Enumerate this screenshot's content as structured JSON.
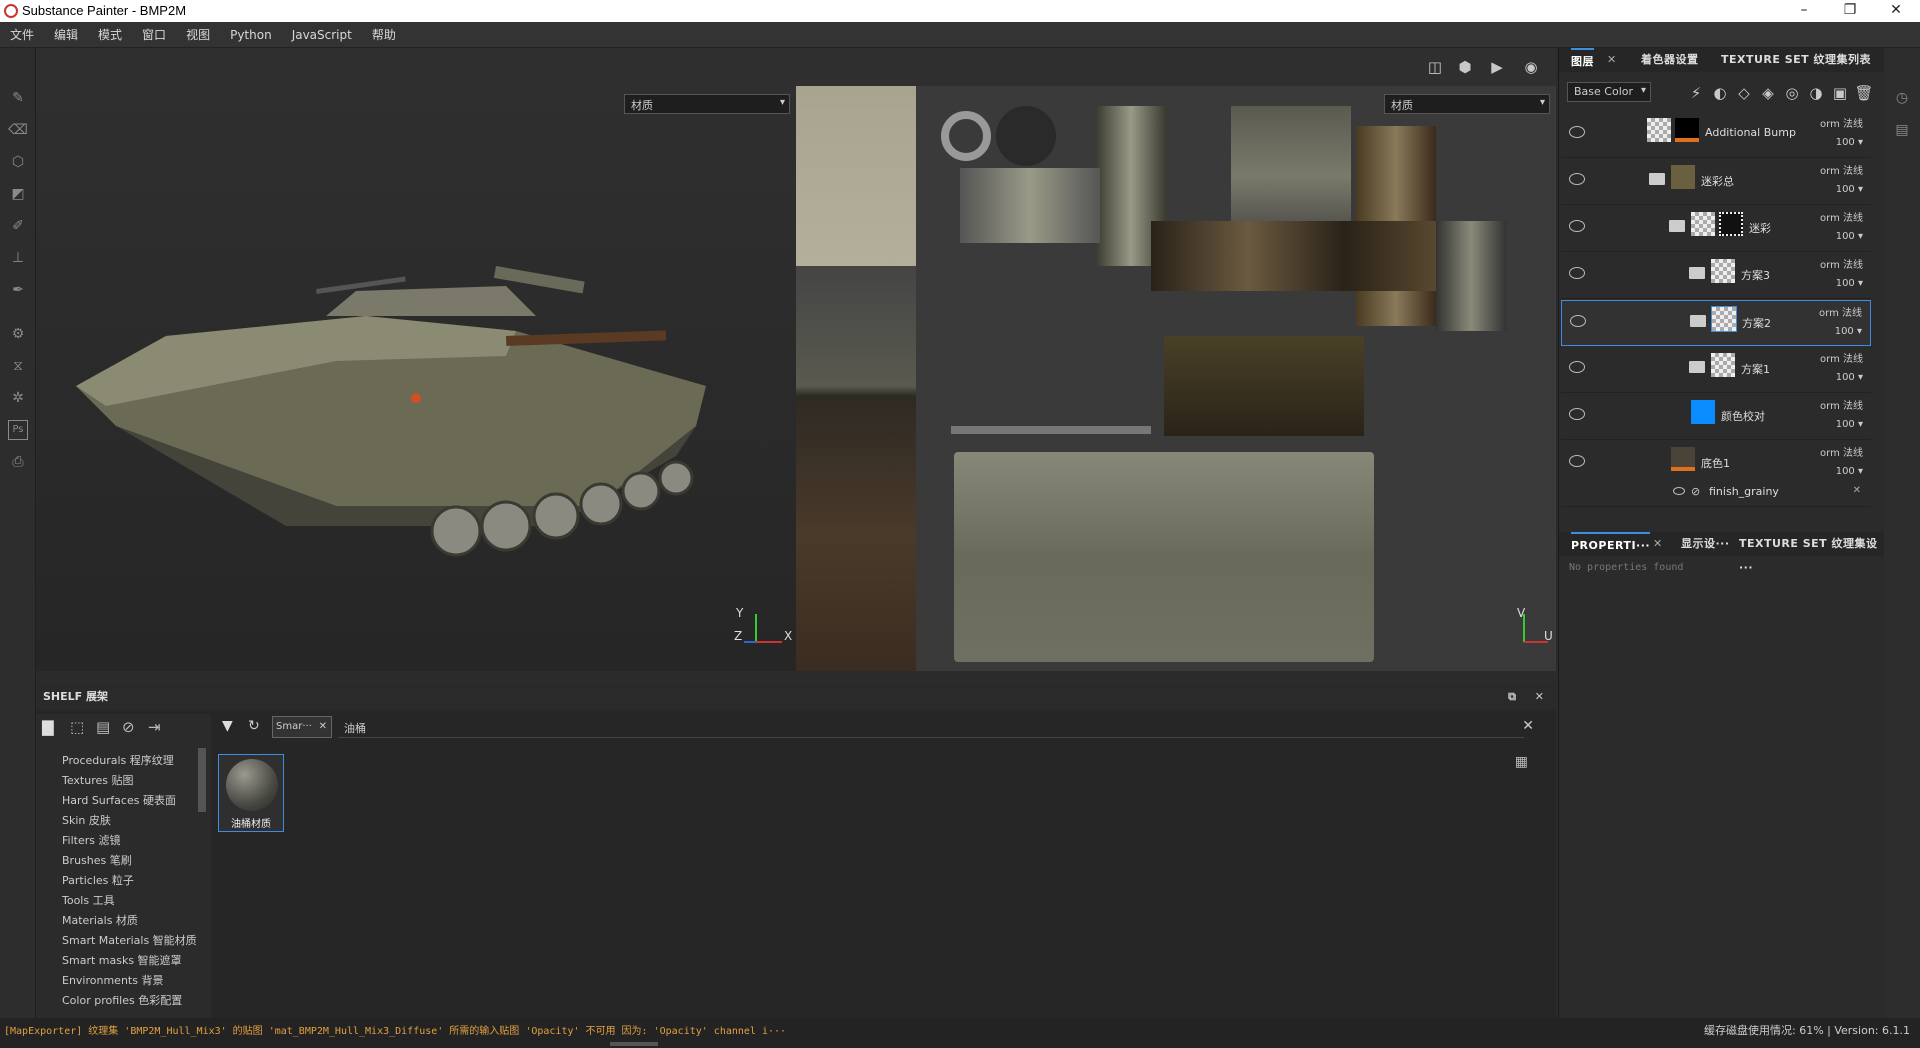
{
  "window": {
    "title": "Substance Painter - BMP2M"
  },
  "menu": [
    "文件",
    "编辑",
    "模式",
    "窗口",
    "视图",
    "Python",
    "JavaScript",
    "帮助"
  ],
  "viewport": {
    "left_dropdown": "材质",
    "right_dropdown": "材质",
    "axis_3d": {
      "y": "Y",
      "z": "Z",
      "x": "X"
    },
    "axis_2d": {
      "v": "V",
      "u": "U"
    }
  },
  "layers_panel": {
    "tabs": [
      "图层",
      "着色器设置",
      "TEXTURE SET 纹理集列表"
    ],
    "channel": "Base Color",
    "layers": [
      {
        "name": "Additional Bump",
        "blend": "orm 法线",
        "opacity": "100"
      },
      {
        "name": "迷彩总",
        "blend": "orm 法线",
        "opacity": "100"
      },
      {
        "name": "迷彩",
        "blend": "orm 法线",
        "opacity": "100"
      },
      {
        "name": "方案3",
        "blend": "orm 法线",
        "opacity": "100"
      },
      {
        "name": "方案2",
        "blend": "orm 法线",
        "opacity": "100"
      },
      {
        "name": "方案1",
        "blend": "orm 法线",
        "opacity": "100"
      },
      {
        "name": "颜色校对",
        "blend": "orm 法线",
        "opacity": "100"
      },
      {
        "name": "底色1",
        "blend": "orm 法线",
        "opacity": "100"
      }
    ],
    "effect": "finish_grainy"
  },
  "properties_panel": {
    "tabs": [
      "PROPERTI···",
      "显示设···",
      "TEXTURE SET 纹理集设···"
    ],
    "empty_text": "No properties found"
  },
  "shelf": {
    "title": "SHELF 展架",
    "categories": [
      "Procedurals 程序纹理",
      "Textures 贴图",
      "Hard Surfaces 硬表面",
      "Skin 皮肤",
      "Filters 滤镜",
      "Brushes 笔刷",
      "Particles 粒子",
      "Tools 工具",
      "Materials 材质",
      "Smart Materials 智能材质",
      "Smart masks 智能遮罩",
      "Environments 背景",
      "Color profiles 色彩配置"
    ],
    "filter_tag": "Smar···",
    "search_value": "油桶",
    "item_label": "油桶材质"
  },
  "status": {
    "message": "[MapExporter] 纹理集 'BMP2M_Hull_Mix3' 的贴图 'mat_BMP2M_Hull_Mix3_Diffuse' 所需的输入贴图 'Opacity' 不可用 因为: 'Opacity' channel i···",
    "right": "缓存磁盘使用情况:  61% | Version: 6.1.1"
  },
  "colors": {
    "accent": "#3d8ee0",
    "orange": "#e07020",
    "blue_layer": "#0a8cff"
  }
}
